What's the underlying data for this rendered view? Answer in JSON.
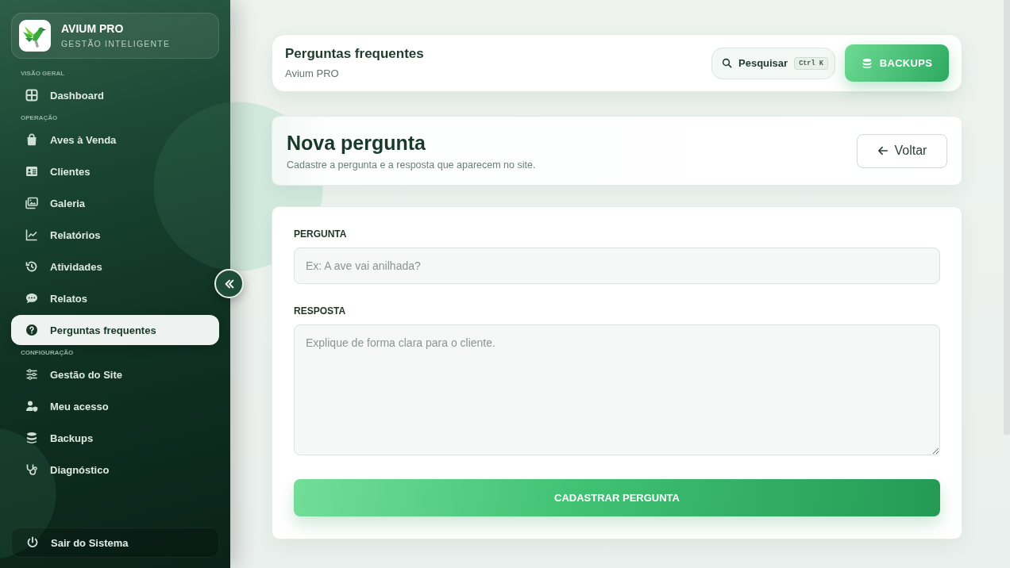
{
  "sidebar": {
    "brand": {
      "title": "AVIUM PRO",
      "subtitle": "GESTÃO INTELIGENTE"
    },
    "sections": [
      {
        "label": "VISÃO GERAL",
        "items": [
          {
            "label": "Dashboard",
            "selected": false
          }
        ]
      },
      {
        "label": "OPERAÇÃO",
        "items": [
          {
            "label": "Aves à Venda",
            "selected": false
          },
          {
            "label": "Clientes",
            "selected": false
          },
          {
            "label": "Galeria",
            "selected": false
          },
          {
            "label": "Relatórios",
            "selected": false
          },
          {
            "label": "Atividades",
            "selected": false
          },
          {
            "label": "Relatos",
            "selected": false
          },
          {
            "label": "Perguntas frequentes",
            "selected": true
          }
        ]
      },
      {
        "label": "CONFIGURAÇÃO",
        "items": [
          {
            "label": "Gestão do Site",
            "selected": false
          },
          {
            "label": "Meu acesso",
            "selected": false
          },
          {
            "label": "Backups",
            "selected": false
          },
          {
            "label": "Diagnóstico",
            "selected": false
          }
        ]
      }
    ],
    "logout": {
      "label": "Sair do Sistema"
    }
  },
  "header": {
    "title": "Perguntas frequentes",
    "subtitle": "Avium PRO",
    "search": {
      "label": "Pesquisar",
      "shortcut": "Ctrl K"
    },
    "backups_button": "BACKUPS"
  },
  "page_heading": {
    "title": "Nova pergunta",
    "subtitle": "Cadastre a pergunta e a resposta que aparecem no site.",
    "back_button": "Voltar"
  },
  "form": {
    "fields": [
      {
        "kind": "input",
        "label": "PERGUNTA",
        "placeholder": "Ex: A ave vai anilhada?"
      },
      {
        "kind": "textarea",
        "label": "RESPOSTA",
        "placeholder": "Explique de forma clara para o cliente."
      }
    ],
    "submit": "CADASTRAR PERGUNTA"
  }
}
